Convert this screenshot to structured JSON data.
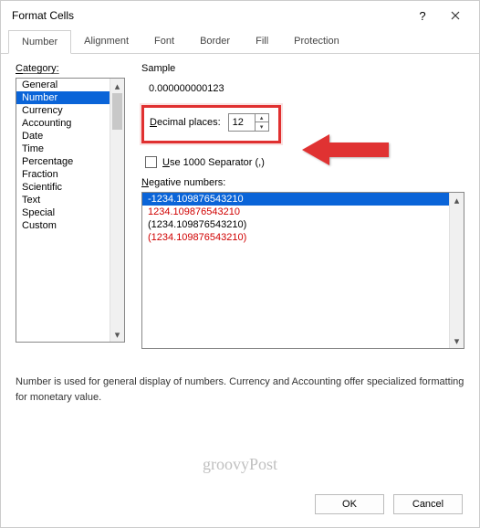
{
  "title": "Format Cells",
  "tabs": [
    "Number",
    "Alignment",
    "Font",
    "Border",
    "Fill",
    "Protection"
  ],
  "activeTab": 0,
  "category": {
    "label": "Category:",
    "items": [
      "General",
      "Number",
      "Currency",
      "Accounting",
      "Date",
      "Time",
      "Percentage",
      "Fraction",
      "Scientific",
      "Text",
      "Special",
      "Custom"
    ],
    "selected": 1
  },
  "sample": {
    "label": "Sample",
    "value": "0.000000000123"
  },
  "decimal": {
    "label": "Decimal places:",
    "value": "12"
  },
  "separator": {
    "label": "Use 1000 Separator (,)",
    "checked": false
  },
  "negative": {
    "label": "Negative numbers:",
    "items": [
      {
        "text": "-1234.109876543210",
        "red": false,
        "sel": true
      },
      {
        "text": "1234.109876543210",
        "red": true,
        "sel": false
      },
      {
        "text": "(1234.109876543210)",
        "red": false,
        "sel": false
      },
      {
        "text": "(1234.109876543210)",
        "red": true,
        "sel": false
      }
    ]
  },
  "description": "Number is used for general display of numbers.  Currency and Accounting offer specialized formatting for monetary value.",
  "buttons": {
    "ok": "OK",
    "cancel": "Cancel"
  },
  "watermark": "groovyPost"
}
